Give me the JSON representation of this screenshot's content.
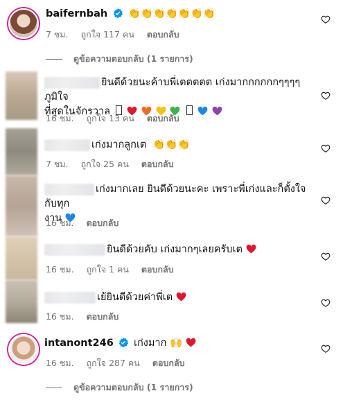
{
  "comments": [
    {
      "username": "baifernbah",
      "verified": true,
      "text": "👏👏👏👏👏👏👏",
      "time": "7 ชม.",
      "likes": "ถูกใจ 117 คน",
      "reply_label": "ตอบกลับ",
      "view_replies": "ดูข้อความตอบกลับ (1 รายการ)"
    },
    {
      "text_line1": "ยินดีด้วยนะค้าบพี่เตตตตต เก่งมากกกกกกๆๆๆๆ ภูมิใจ",
      "text_line2": "ที่สุดในจักรวาล",
      "time": "16 ชม.",
      "likes": "ถูกใจ 13 คน",
      "reply_label": "ตอบกลับ"
    },
    {
      "text": "เก่งมากลูกเต",
      "time": "7 ชม.",
      "likes": "ถูกใจ 25 คน",
      "reply_label": "ตอบกลับ"
    },
    {
      "text_line1": "เก่งมากเลย ยินดีด้วยนะคะ เพราะพี่เก่งและก็ตั้งใจกับทุก",
      "text_line2": "งาน",
      "time": "16 ชม.",
      "reply_label": "ตอบกลับ"
    },
    {
      "text": "ยินดีด้วยคับ เก่งมากๆเลยครับเต",
      "time": "16 ชม.",
      "likes": "ถูกใจ 1 คน",
      "reply_label": "ตอบกลับ"
    },
    {
      "text": "เย้ยินดีด้วยค่าพี่เต",
      "time": "16 ชม.",
      "reply_label": "ตอบกลับ"
    },
    {
      "username": "intanont246",
      "verified": true,
      "text": "เก่งมาก",
      "time": "16 ชม.",
      "likes": "ถูกใจ 287 คน",
      "reply_label": "ตอบกลับ",
      "view_replies": "ดูข้อความตอบกลับ (1 รายการ)"
    }
  ],
  "colors": {
    "verified_blue": "#0095f6",
    "meta_gray": "#737373",
    "heart_red": "#e0162b",
    "hearts": [
      "#e0162b",
      "#f26b1d",
      "#f4c20d",
      "#3bb54a",
      "#1e88e5",
      "#8e44ad"
    ]
  }
}
